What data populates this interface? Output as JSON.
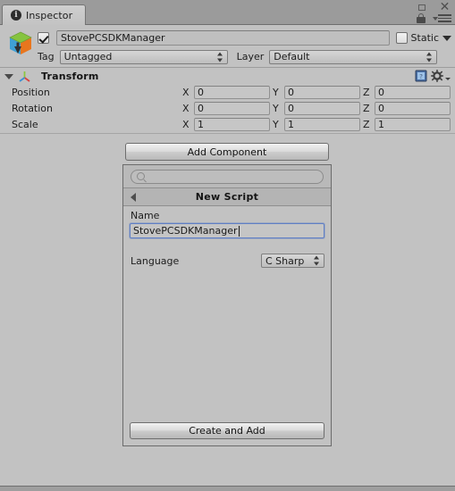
{
  "window": {
    "tab_label": "Inspector",
    "tab_icon": "info-icon",
    "controls": {
      "maximize": "maximize-icon",
      "close": "close-icon",
      "lock": "lock-icon",
      "menu": "hamburger-menu-icon"
    }
  },
  "object_header": {
    "enabled_checkbox": true,
    "icon": "gameobject-cube-icon",
    "name": "StovePCSDKManager",
    "static_label": "Static",
    "static_checked": false,
    "tag_label": "Tag",
    "tag_value": "Untagged",
    "layer_label": "Layer",
    "layer_value": "Default"
  },
  "transform": {
    "title": "Transform",
    "expanded": true,
    "icon": "transform-axis-icon",
    "help_icon": "book-help-icon",
    "settings_icon": "gear-icon",
    "rows": [
      {
        "label": "Position",
        "x": "0",
        "y": "0",
        "z": "0"
      },
      {
        "label": "Rotation",
        "x": "0",
        "y": "0",
        "z": "0"
      },
      {
        "label": "Scale",
        "x": "1",
        "y": "1",
        "z": "1"
      }
    ],
    "axis_labels": {
      "x": "X",
      "y": "Y",
      "z": "Z"
    }
  },
  "add_component": {
    "button_label": "Add Component",
    "search_placeholder": "",
    "search_value": "",
    "panel_title": "New Script",
    "name_label": "Name",
    "name_value": "StovePCSDKManager",
    "language_label": "Language",
    "language_value": "C Sharp",
    "create_label": "Create and Add"
  },
  "colors": {
    "background": "#c2c2c2",
    "tabbar": "#9b9b9b",
    "focus_border": "#5f7fc4",
    "cube_green": "#7ac943",
    "cube_blue": "#3b9fd8",
    "cube_orange": "#e8741a"
  }
}
